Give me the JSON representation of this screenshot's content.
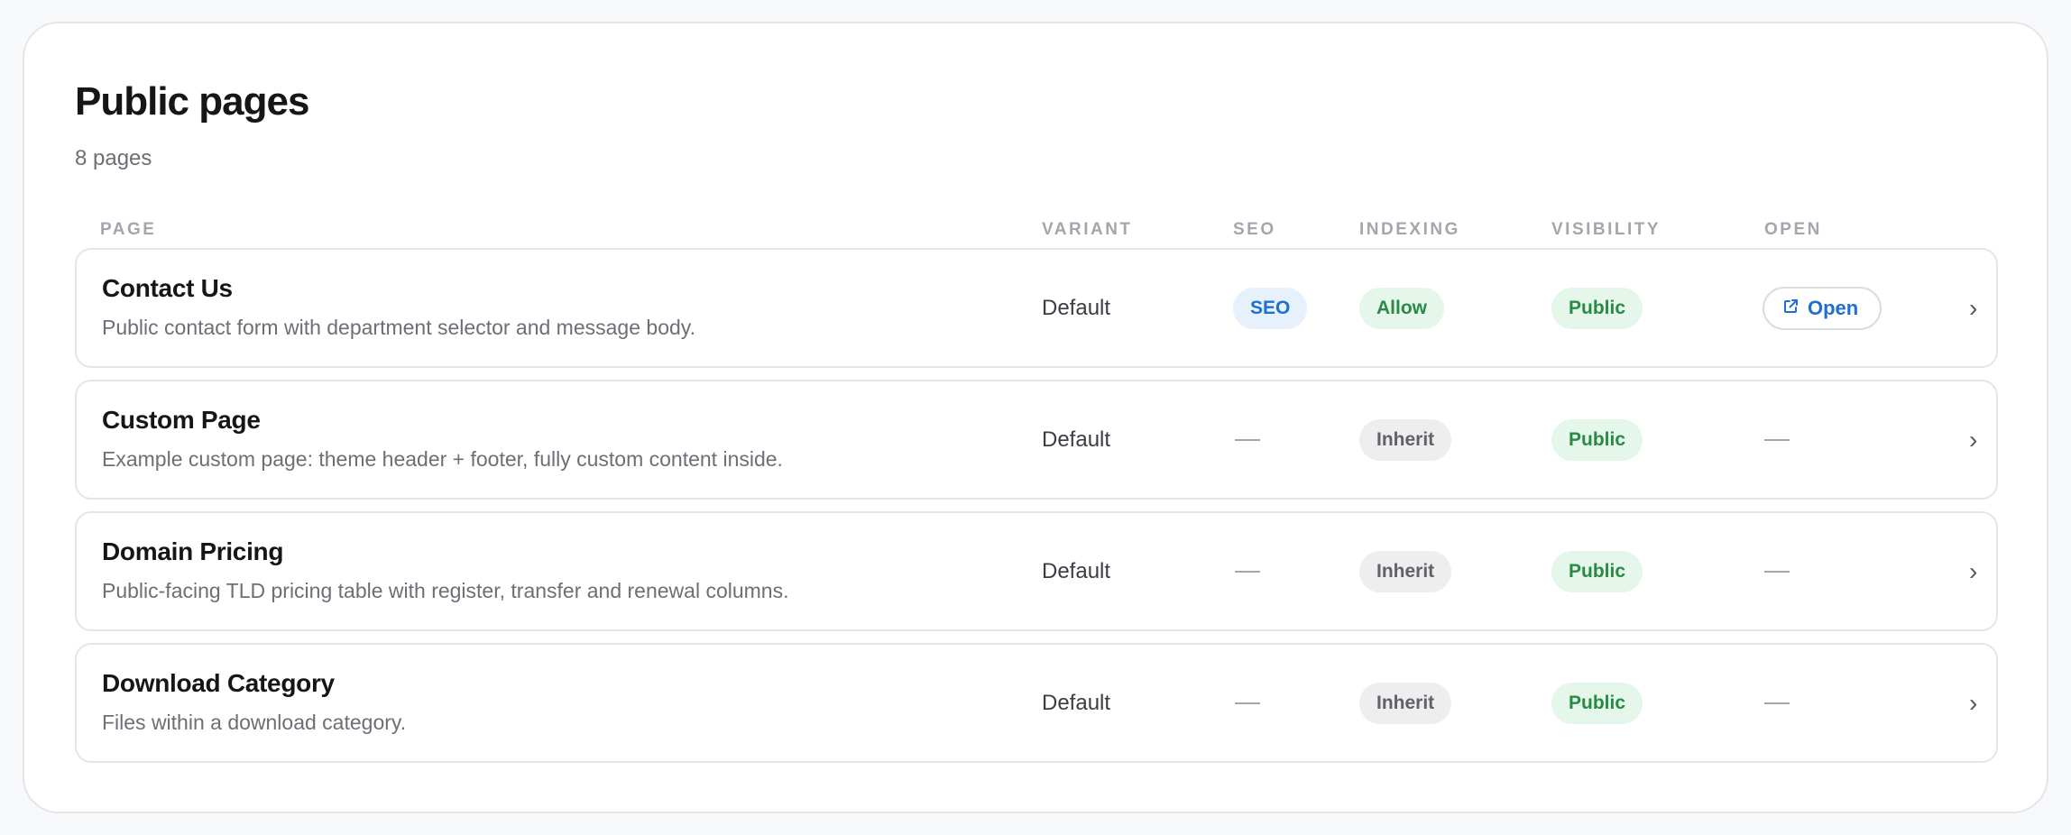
{
  "header": {
    "title": "Public pages",
    "count": "8 pages"
  },
  "columns": {
    "page": "PAGE",
    "variant": "VARIANT",
    "seo": "SEO",
    "indexing": "INDEXING",
    "visibility": "VISIBILITY",
    "open": "OPEN"
  },
  "rows": [
    {
      "title": "Contact Us",
      "description": "Public contact form with department selector and message body.",
      "variant": "Default",
      "seo": "SEO",
      "indexing": "Allow",
      "visibility": "Public",
      "open": "Open"
    },
    {
      "title": "Custom Page",
      "description": "Example custom page: theme header + footer, fully custom content inside.",
      "variant": "Default",
      "indexing": "Inherit",
      "visibility": "Public"
    },
    {
      "title": "Domain Pricing",
      "description": "Public-facing TLD pricing table with register, transfer and renewal columns.",
      "variant": "Default",
      "indexing": "Inherit",
      "visibility": "Public"
    },
    {
      "title": "Download Category",
      "description": "Files within a download category.",
      "variant": "Default",
      "indexing": "Inherit",
      "visibility": "Public"
    }
  ],
  "icons": {
    "open": "external-link-icon",
    "row_arrow": "chevron-right-icon",
    "empty": "dash"
  },
  "colors": {
    "accent_blue": "#1f6fd1",
    "success_green": "#2a8a45",
    "neutral_grey": "#5f6268"
  }
}
